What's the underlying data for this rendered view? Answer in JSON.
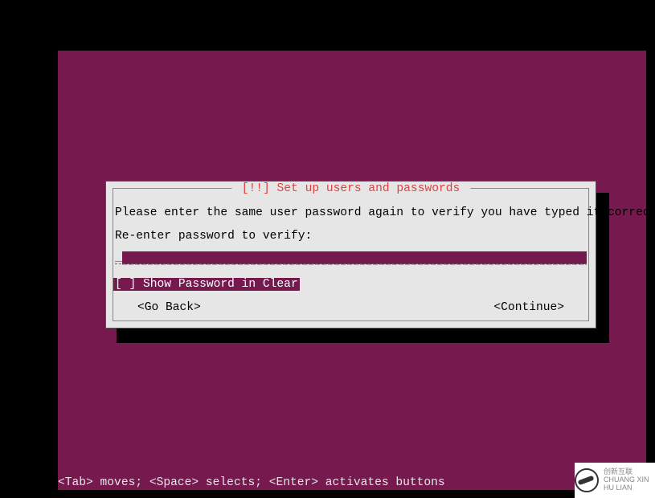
{
  "dialog": {
    "title": " [!!] Set up users and passwords ",
    "instruction": "Please enter the same user password again to verify you have typed it correctly.",
    "prompt": "Re-enter password to verify:",
    "password_value": "",
    "checkbox": {
      "checked": false,
      "label": "Show Password in Clear"
    },
    "buttons": {
      "back": "<Go Back>",
      "continue": "<Continue>"
    }
  },
  "help_bar": "<Tab> moves; <Space> selects; <Enter> activates buttons",
  "watermark": {
    "line1": "创新互联",
    "line2": "CHUANG XIN HU LIAN"
  }
}
